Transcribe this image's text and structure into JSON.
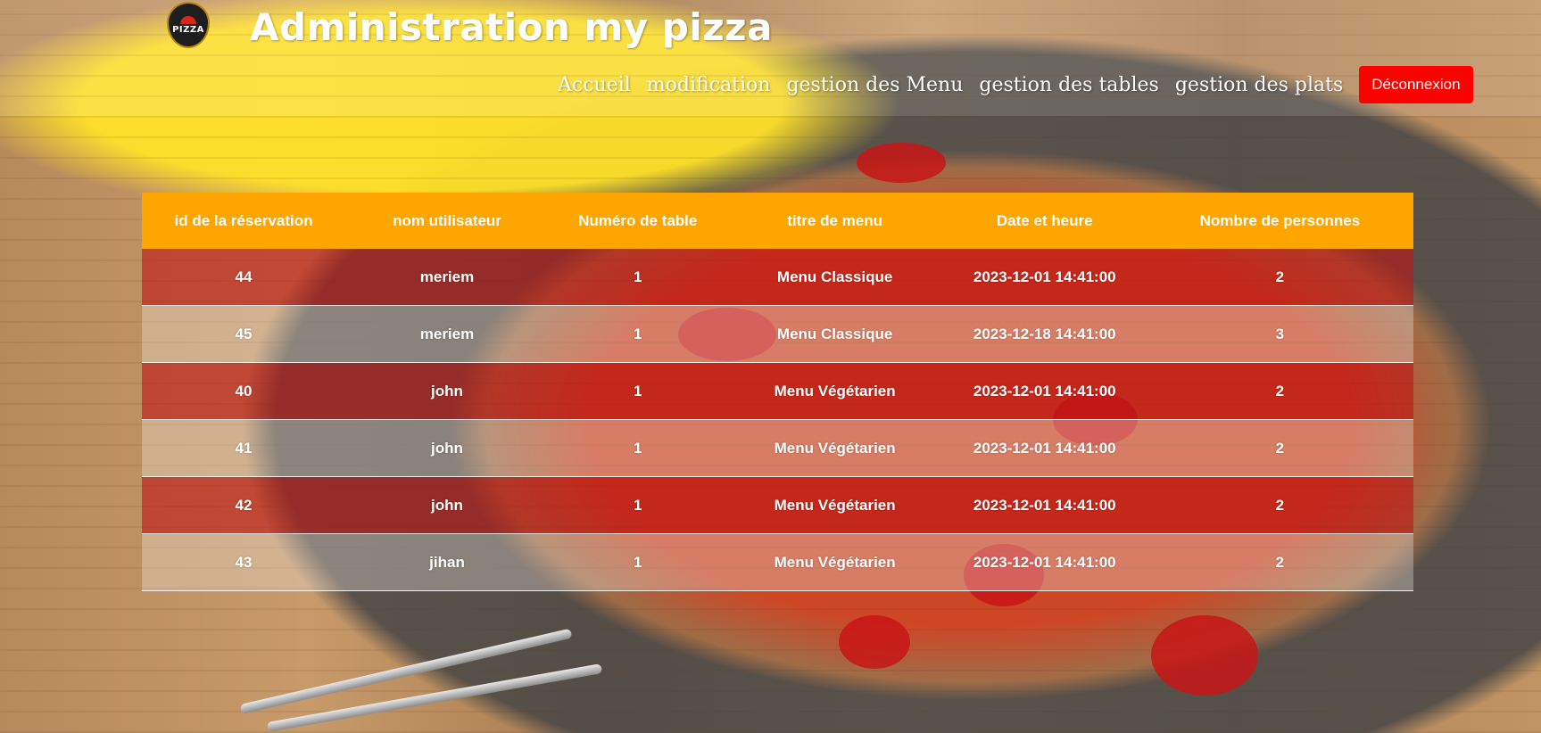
{
  "header": {
    "logo_text": "PIZZA",
    "title": "Administration my pizza"
  },
  "nav": {
    "items": [
      {
        "label": "Accueil"
      },
      {
        "label": "modification"
      },
      {
        "label": "gestion des Menu"
      },
      {
        "label": "gestion des tables"
      },
      {
        "label": "gestion des plats"
      }
    ],
    "logout_label": "Déconnexion"
  },
  "colors": {
    "header_row": "#ffa500",
    "logout_button": "#ff0000",
    "row_odd": "rgba(190,20,20,0.60)",
    "text": "#ffffff"
  },
  "reservations": {
    "columns": [
      "id de la réservation",
      "nom utilisateur",
      "Numéro de table",
      "titre de menu",
      "Date et heure",
      "Nombre de personnes"
    ],
    "rows": [
      [
        "44",
        "meriem",
        "1",
        "Menu Classique",
        "2023-12-01 14:41:00",
        "2"
      ],
      [
        "45",
        "meriem",
        "1",
        "Menu Classique",
        "2023-12-18 14:41:00",
        "3"
      ],
      [
        "40",
        "john",
        "1",
        "Menu Végétarien",
        "2023-12-01 14:41:00",
        "2"
      ],
      [
        "41",
        "john",
        "1",
        "Menu Végétarien",
        "2023-12-01 14:41:00",
        "2"
      ],
      [
        "42",
        "john",
        "1",
        "Menu Végétarien",
        "2023-12-01 14:41:00",
        "2"
      ],
      [
        "43",
        "jihan",
        "1",
        "Menu Végétarien",
        "2023-12-01 14:41:00",
        "2"
      ]
    ]
  }
}
